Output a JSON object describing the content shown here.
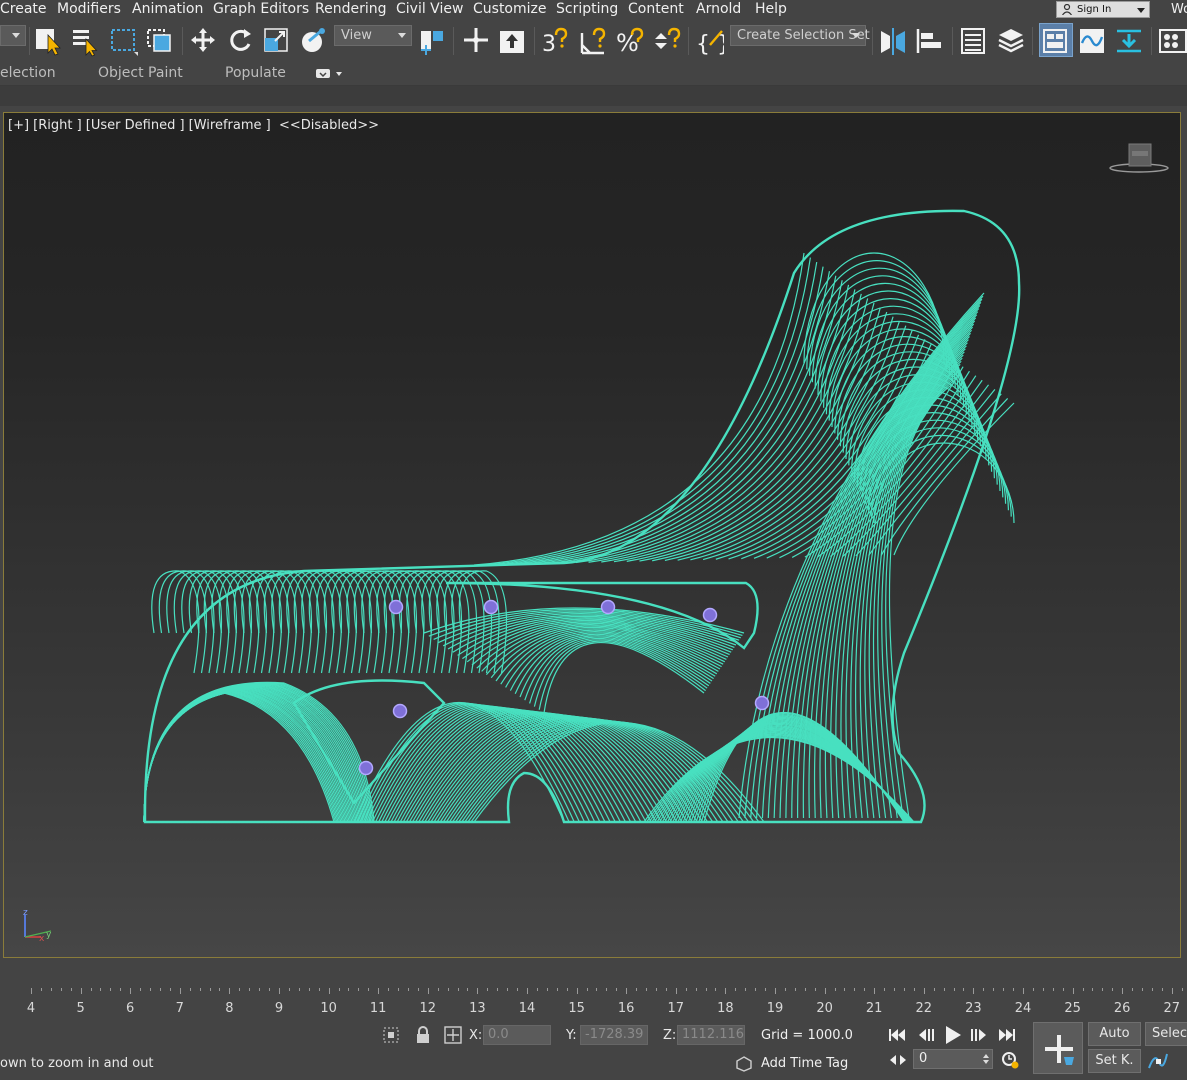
{
  "menu": [
    "Create",
    "Modifiers",
    "Animation",
    "Graph Editors",
    "Rendering",
    "Civil View",
    "Customize",
    "Scripting",
    "Content",
    "Arnold",
    "Help"
  ],
  "account": {
    "signin_label": "Sign In",
    "workspace_fragment": "Wo"
  },
  "toolbar": {
    "reference_dropdown": "View",
    "selection_set_dropdown": "Create Selection Set"
  },
  "ribbon": {
    "tabs": [
      "election",
      "Object Paint",
      "Populate"
    ]
  },
  "viewport": {
    "label": "[+] [Right ] [User Defined ] [Wireframe ]  <<Disabled>>",
    "wire_color": "#48e0c0",
    "highlight_color": "#8a7c3a"
  },
  "timeline": {
    "ticks": [
      "4",
      "5",
      "6",
      "7",
      "8",
      "9",
      "10",
      "11",
      "12",
      "13",
      "14",
      "15",
      "16",
      "17",
      "18",
      "19",
      "20",
      "21",
      "22",
      "23",
      "24",
      "25",
      "26",
      "27"
    ]
  },
  "status": {
    "prompt": "own to zoom in and out",
    "x_label": "X:",
    "x_value": "0.0",
    "y_label": "Y:",
    "y_value": "-1728.39",
    "z_label": "Z:",
    "z_value": "1112.116",
    "grid": "Grid = 1000.0",
    "add_time_tag": "Add Time Tag",
    "frame_value": "0",
    "auto_key": "Auto",
    "set_key": "Set K.",
    "selected": "Selecte"
  }
}
